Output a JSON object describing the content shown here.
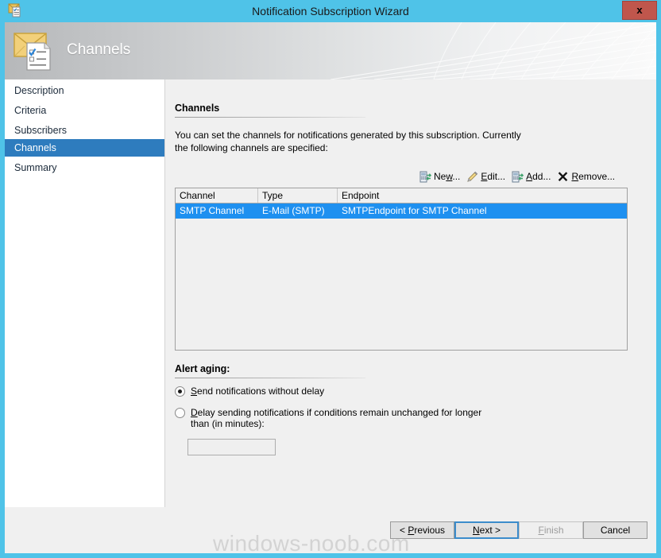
{
  "window": {
    "title": "Notification Subscription Wizard",
    "close_label": "x",
    "title_icon": "wizard-checklist-icon"
  },
  "banner": {
    "heading": "Channels",
    "icon": "envelope-checklist-icon"
  },
  "sidebar": {
    "items": [
      {
        "label": "Description",
        "selected": false
      },
      {
        "label": "Criteria",
        "selected": false
      },
      {
        "label": "Subscribers",
        "selected": false
      },
      {
        "label": "Channels",
        "selected": true
      },
      {
        "label": "Summary",
        "selected": false
      }
    ]
  },
  "content": {
    "section_title": "Channels",
    "description": "You can set the channels for notifications generated by this subscription.  Currently the following channels are specified:",
    "toolbar": [
      {
        "label": "New...",
        "accel": "w",
        "icon": "new-channel-icon"
      },
      {
        "label": "Edit...",
        "accel": "E",
        "icon": "pencil-icon"
      },
      {
        "label": "Add...",
        "accel": "A",
        "icon": "add-channel-icon"
      },
      {
        "label": "Remove...",
        "accel": "R",
        "icon": "remove-x-icon"
      }
    ],
    "table": {
      "columns": [
        "Channel",
        "Type",
        "Endpoint"
      ],
      "rows": [
        {
          "channel": "SMTP Channel",
          "type": "E-Mail (SMTP)",
          "endpoint": "SMTPEndpoint for SMTP Channel",
          "selected": true
        }
      ]
    },
    "alert_aging": {
      "section_title": "Alert aging:",
      "option_no_delay": "Send notifications without delay",
      "option_no_delay_accel": "S",
      "option_no_delay_selected": true,
      "option_delay": "Delay sending notifications if conditions remain unchanged for longer than (in minutes):",
      "option_delay_accel": "D",
      "option_delay_selected": false,
      "delay_value": "",
      "delay_placeholder": ""
    }
  },
  "footer": {
    "previous": "< Previous",
    "previous_accel": "P",
    "next": "Next >",
    "next_accel": "N",
    "finish": "Finish",
    "finish_accel": "F",
    "cancel": "Cancel",
    "watermark": "windows-noob.com"
  },
  "colors": {
    "title_bar": "#4FC3E8",
    "close_button": "#C0564C",
    "sidebar_selected": "#2E7CBE",
    "row_selected": "#1E90F0",
    "panel_bg": "#F0F0F0",
    "default_button_border": "#3C8CCB"
  }
}
